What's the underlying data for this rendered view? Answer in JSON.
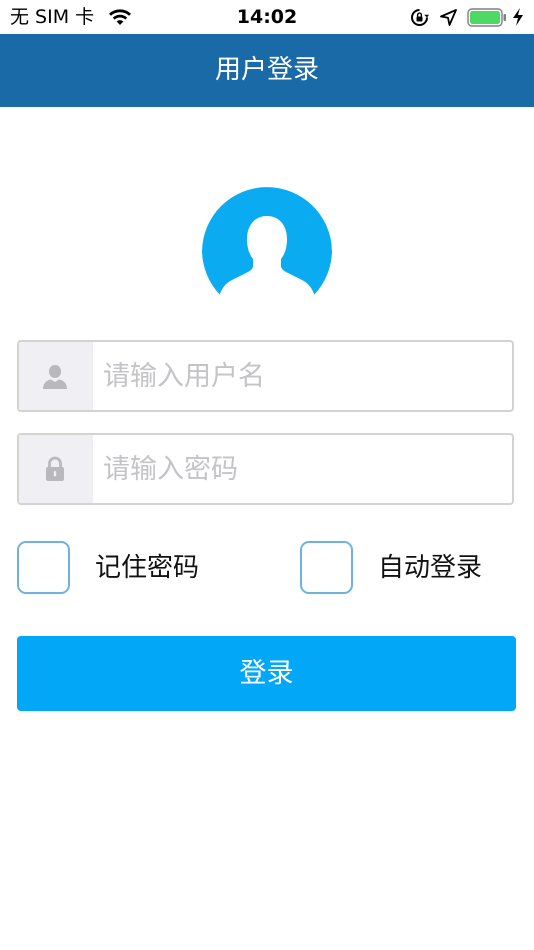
{
  "status_bar": {
    "carrier": "无 SIM 卡",
    "time": "14:02",
    "battery_color": "#4cd964"
  },
  "nav": {
    "title": "用户登录",
    "color": "#1a6aa8"
  },
  "form": {
    "username_placeholder": "请输入用户名",
    "password_placeholder": "请输入密码",
    "remember_label": "记住密码",
    "auto_login_label": "自动登录",
    "login_label": "登录",
    "accent_color": "#02a7f8",
    "remember_checked": false,
    "auto_login_checked": false
  },
  "icons": {
    "avatar": "user-silhouette-icon",
    "username": "person-icon",
    "password": "lock-icon"
  }
}
